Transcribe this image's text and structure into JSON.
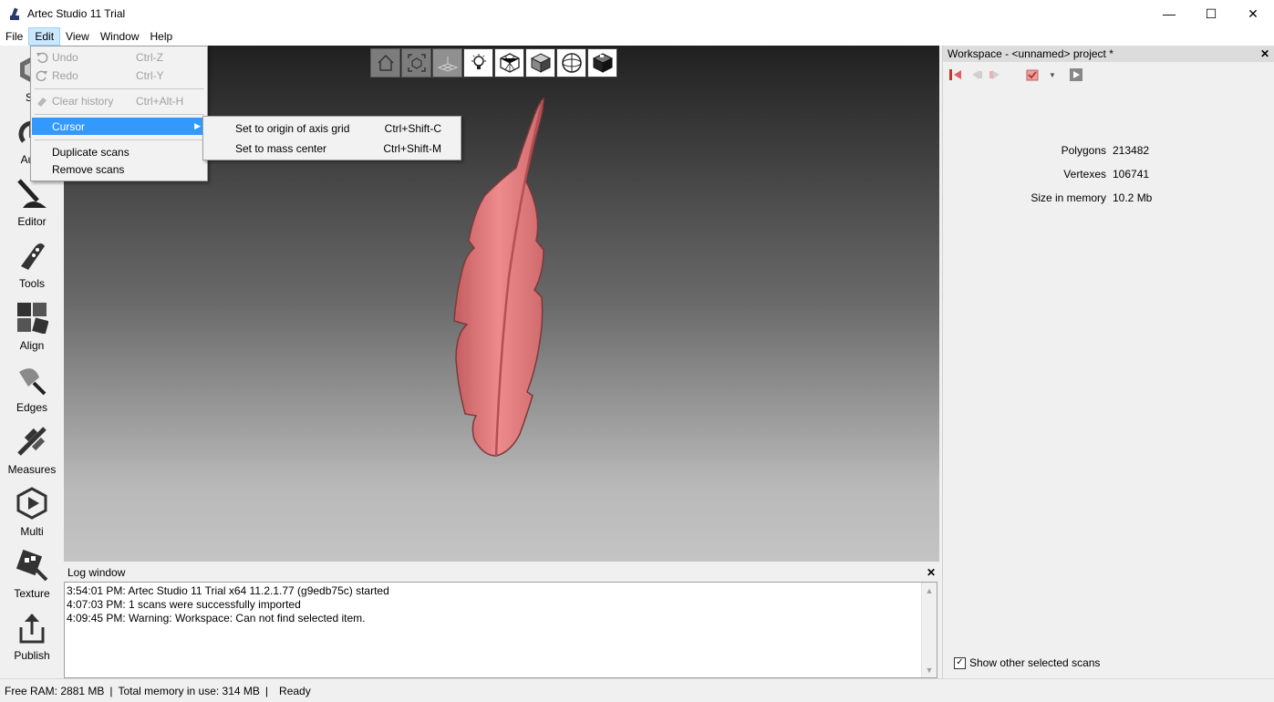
{
  "window": {
    "title": "Artec Studio 11 Trial",
    "minimize": "—",
    "maximize": "☐",
    "close": "✕"
  },
  "menubar": [
    {
      "label": "File"
    },
    {
      "label": "Edit"
    },
    {
      "label": "View"
    },
    {
      "label": "Window"
    },
    {
      "label": "Help"
    }
  ],
  "edit_menu": {
    "undo": {
      "label": "Undo",
      "shortcut": "Ctrl-Z"
    },
    "redo": {
      "label": "Redo",
      "shortcut": "Ctrl-Y"
    },
    "clear_history": {
      "label": "Clear history",
      "shortcut": "Ctrl+Alt-H"
    },
    "cursor": {
      "label": "Cursor"
    },
    "duplicate": {
      "label": "Duplicate scans"
    },
    "remove": {
      "label": "Remove scans"
    }
  },
  "cursor_submenu": {
    "origin": {
      "label": "Set to origin of axis grid",
      "shortcut": "Ctrl+Shift-C"
    },
    "mass": {
      "label": "Set to mass center",
      "shortcut": "Ctrl+Shift-M"
    }
  },
  "left_toolbar": {
    "scan": "Sc",
    "autopilot": "Auto",
    "editor": "Editor",
    "tools": "Tools",
    "align": "Align",
    "edges": "Edges",
    "measures": "Measures",
    "multi": "Multi",
    "texture": "Texture",
    "publish": "Publish"
  },
  "log": {
    "title": "Log window",
    "close": "✕",
    "lines": [
      "3:54:01 PM: Artec Studio 11 Trial x64 11.2.1.77 (g9edb75c) started",
      "4:07:03 PM: 1 scans were successfully imported",
      "4:09:45 PM: Warning: Workspace: Can not find selected item."
    ]
  },
  "workspace": {
    "title": "Workspace - <unnamed> project *",
    "close": "✕",
    "stats": [
      {
        "key": "Polygons",
        "value": "213482"
      },
      {
        "key": "Vertexes",
        "value": "106741"
      },
      {
        "key": "Size in memory",
        "value": "10.2 Mb"
      }
    ],
    "show_other": {
      "label": "Show other selected scans",
      "checked": true,
      "mark": "✓"
    }
  },
  "statusbar": {
    "free_ram": "Free RAM: 2881 MB",
    "sep1": "|",
    "total_memory": "Total memory in use: 314 MB",
    "sep2": "|",
    "state": "Ready"
  },
  "colors": {
    "feather": "#e5777a",
    "accent": "#3399ff",
    "menu_active": "#cce8ff"
  },
  "icons": [
    "home-view-icon",
    "fit-view-icon",
    "grid-icon",
    "light-bulb-icon",
    "wireframe-cube-icon",
    "solid-cube-icon",
    "sphere-icon",
    "textured-cube-icon"
  ]
}
